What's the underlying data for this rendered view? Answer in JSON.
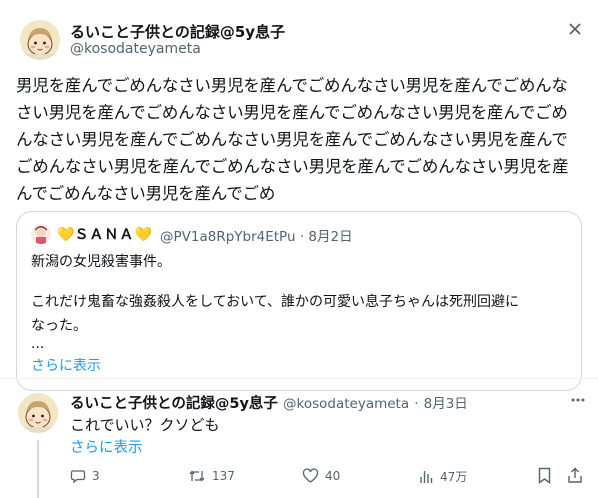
{
  "post": {
    "display_name": "るいこと子供との記録@5y息子",
    "handle": "@kosodateyameta",
    "text": "男児を産んでごめんなさい男児を産んでごめんなさい男児を産んでごめんなさい男児を産んでごめんなさい男児を産んでごめんなさい男児を産んでごめんなさい男児を産んでごめんなさい男児を産んでごめんなさい男児を産んでごめんなさい男児を産んでごめんなさい男児を産んでごめんなさい男児を産んでごめんなさい男児を産んでごめ"
  },
  "quote": {
    "display_name_prefix": "💛",
    "display_name": "ＳＡＮＡ",
    "display_name_suffix": "💛",
    "handle": "@PV1a8RpYbr4EtPu",
    "separator": "·",
    "date": "8月2日",
    "line1": "新潟の女児殺害事件。",
    "line2": "これだけ鬼畜な強姦殺人をしておいて、誰かの可愛い息子ちゃんは死刑回避に",
    "line3": "なった。",
    "ellipsis": "...",
    "show_more": "さらに表示"
  },
  "reply": {
    "display_name": "るいこと子供との記録@5y息子",
    "handle": "@kosodateyameta",
    "separator": "·",
    "date": "8月3日",
    "text": "これでいい？クソども",
    "show_more": "さらに表示",
    "actions": {
      "reply_count": "3",
      "retweet_count": "137",
      "like_count": "40",
      "view_count": "47万"
    }
  },
  "icons": {
    "close": "x-close-icon",
    "reply": "speech-bubble-icon",
    "retweet": "retweet-icon",
    "like": "heart-icon",
    "views": "bar-chart-icon",
    "bookmark": "bookmark-icon",
    "share": "share-icon"
  },
  "colors": {
    "link": "#1d9bf0",
    "muted": "#536471",
    "border": "#cfd9de",
    "text": "#0f1419"
  }
}
